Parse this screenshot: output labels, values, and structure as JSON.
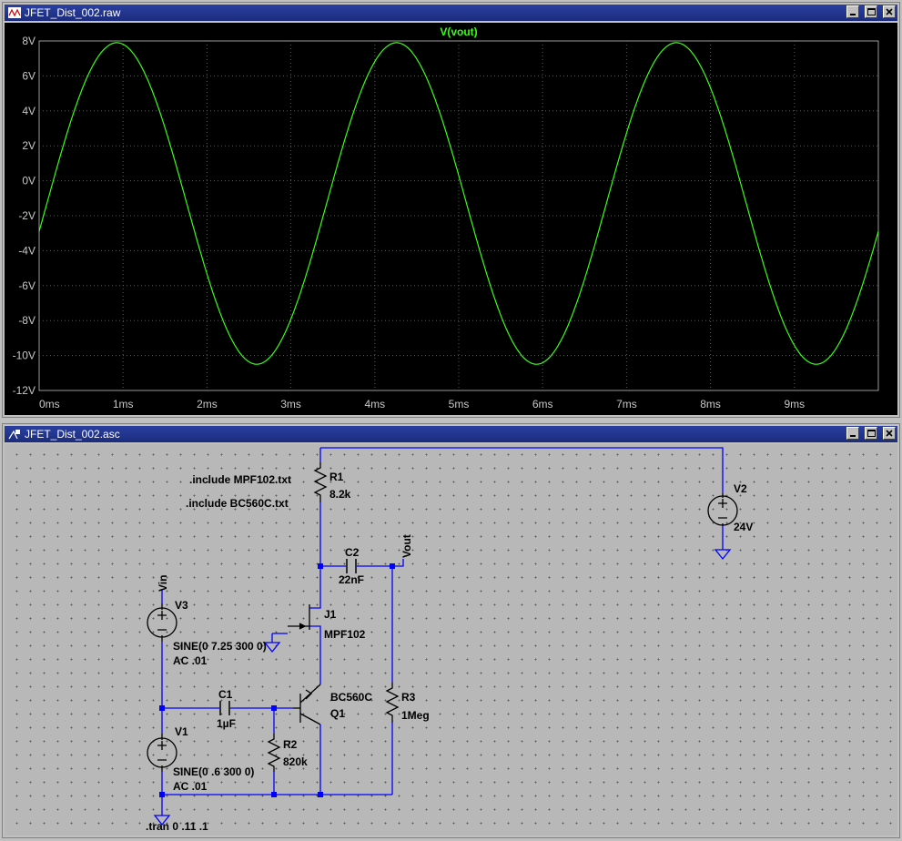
{
  "colors": {
    "trace": "#39ff14",
    "wire": "#0000ff",
    "titlebar": "#1c2c7c"
  },
  "plot_window": {
    "title": "JFET_Dist_002.raw",
    "trace_label": "V(vout)"
  },
  "chart_data": {
    "type": "line",
    "title": "V(vout)",
    "xlabel": "",
    "ylabel": "",
    "x_ticks": [
      "0ms",
      "1ms",
      "2ms",
      "3ms",
      "4ms",
      "5ms",
      "6ms",
      "7ms",
      "8ms",
      "9ms"
    ],
    "y_ticks": [
      "8V",
      "6V",
      "4V",
      "2V",
      "0V",
      "-2V",
      "-4V",
      "-6V",
      "-8V",
      "-10V",
      "-12V"
    ],
    "xlim": [
      0,
      10
    ],
    "ylim": [
      -12,
      8
    ],
    "x_unit": "ms",
    "y_unit": "V",
    "series": [
      {
        "name": "V(vout)",
        "waveform": "sine",
        "frequency_hz": 300,
        "offset_v": -1.3,
        "amplitude_v": 9.2,
        "phase_deg": -10
      }
    ],
    "grid": true
  },
  "schematic_window": {
    "title": "JFET_Dist_002.asc",
    "directives": [
      ".include MPF102.txt",
      ".include BC560C.txt",
      ".tran 0 .11 .1"
    ],
    "net_labels": {
      "vout": "Vout",
      "vin": "Vin"
    },
    "components": {
      "r1": {
        "ref": "R1",
        "value": "8.2k"
      },
      "r2": {
        "ref": "R2",
        "value": "820k"
      },
      "r3": {
        "ref": "R3",
        "value": "1Meg"
      },
      "c1": {
        "ref": "C1",
        "value": "1µF"
      },
      "c2": {
        "ref": "C2",
        "value": "22nF"
      },
      "j1": {
        "ref": "J1",
        "value": "MPF102"
      },
      "q1": {
        "ref": "Q1",
        "value": "BC560C"
      },
      "v1": {
        "ref": "V1",
        "value1": "SINE(0 .6 300 0)",
        "value2": "AC .01"
      },
      "v2": {
        "ref": "V2",
        "value": "24V"
      },
      "v3": {
        "ref": "V3",
        "value1": "SINE(0 7.25 300 0)",
        "value2": "AC .01"
      }
    }
  }
}
